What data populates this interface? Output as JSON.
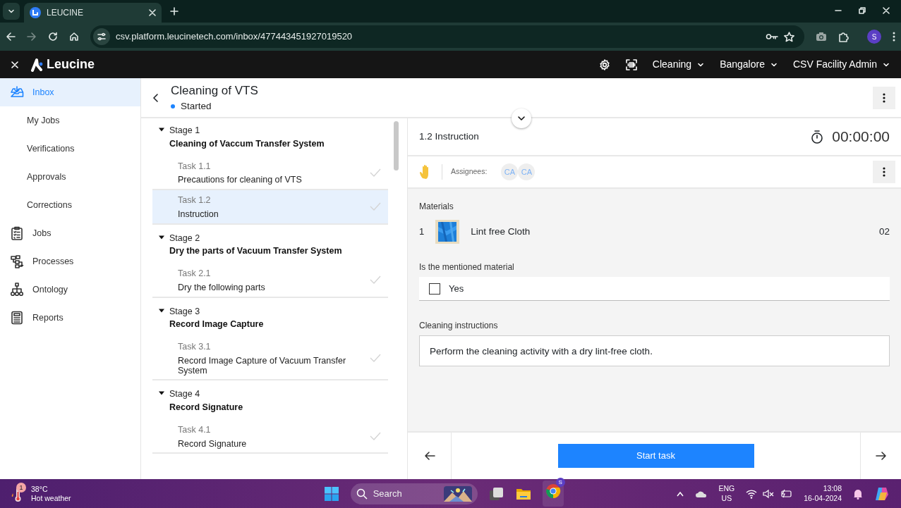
{
  "browser": {
    "tab_title": "LEUCINE",
    "url": "csv.platform.leucinetech.com/inbox/477443451927019520",
    "profile": "S"
  },
  "app_header": {
    "logo": "Leucine",
    "dropdowns": [
      "Cleaning",
      "Bangalore",
      "CSV Facility Admin"
    ]
  },
  "sidebar": {
    "items": [
      {
        "label": "Inbox",
        "kind": "main",
        "selected": true
      },
      {
        "label": "My Jobs",
        "kind": "sub",
        "selected": false
      },
      {
        "label": "Verifications",
        "kind": "sub",
        "selected": false
      },
      {
        "label": "Approvals",
        "kind": "sub",
        "selected": false
      },
      {
        "label": "Corrections",
        "kind": "sub",
        "selected": false
      },
      {
        "label": "Jobs",
        "kind": "main",
        "selected": false
      },
      {
        "label": "Processes",
        "kind": "main",
        "selected": false
      },
      {
        "label": "Ontology",
        "kind": "main",
        "selected": false
      },
      {
        "label": "Reports",
        "kind": "main",
        "selected": false
      }
    ]
  },
  "job": {
    "title": "Cleaning of VTS",
    "status": "Started"
  },
  "stages": [
    {
      "label": "Stage 1",
      "name": "Cleaning of Vaccum Transfer System",
      "expanded": true,
      "tasks": [
        {
          "number": "Task 1.1",
          "name": "Precautions for cleaning of VTS",
          "selected": false
        },
        {
          "number": "Task 1.2",
          "name": "Instruction",
          "selected": true
        }
      ]
    },
    {
      "label": "Stage 2",
      "name": "Dry the parts of Vacuum Transfer System",
      "expanded": true,
      "tasks": [
        {
          "number": "Task 2.1",
          "name": "Dry the following parts",
          "selected": false
        }
      ]
    },
    {
      "label": "Stage 3",
      "name": "Record Image Capture",
      "expanded": true,
      "tasks": [
        {
          "number": "Task 3.1",
          "name": "Record Image Capture of Vacuum Transfer System",
          "selected": false
        }
      ]
    },
    {
      "label": "Stage 4",
      "name": "Record Signature",
      "expanded": true,
      "tasks": [
        {
          "number": "Task 4.1",
          "name": "Record Signature",
          "selected": false
        }
      ]
    }
  ],
  "task": {
    "heading": "1.2 Instruction",
    "timer": "00:00:00",
    "assignees_label": "Assignees:",
    "assignees": [
      "CA",
      "CA"
    ],
    "materials_label": "Materials",
    "materials": [
      {
        "index": "1",
        "name": "Lint free Cloth",
        "quantity": "02"
      }
    ],
    "question": {
      "label": "Is the mentioned material",
      "options": [
        {
          "label": "Yes",
          "checked": false
        }
      ]
    },
    "instructions": {
      "label": "Cleaning instructions",
      "value": "Perform the cleaning activity with a dry lint-free cloth."
    },
    "start_button": "Start task"
  },
  "taskbar": {
    "weather_badge": "1",
    "temperature": "38°C",
    "condition": "Hot weather",
    "search_placeholder": "Search",
    "chrome_badge": "S",
    "lang": "ENG",
    "region": "US",
    "time": "13:08",
    "date": "16-04-2024"
  }
}
